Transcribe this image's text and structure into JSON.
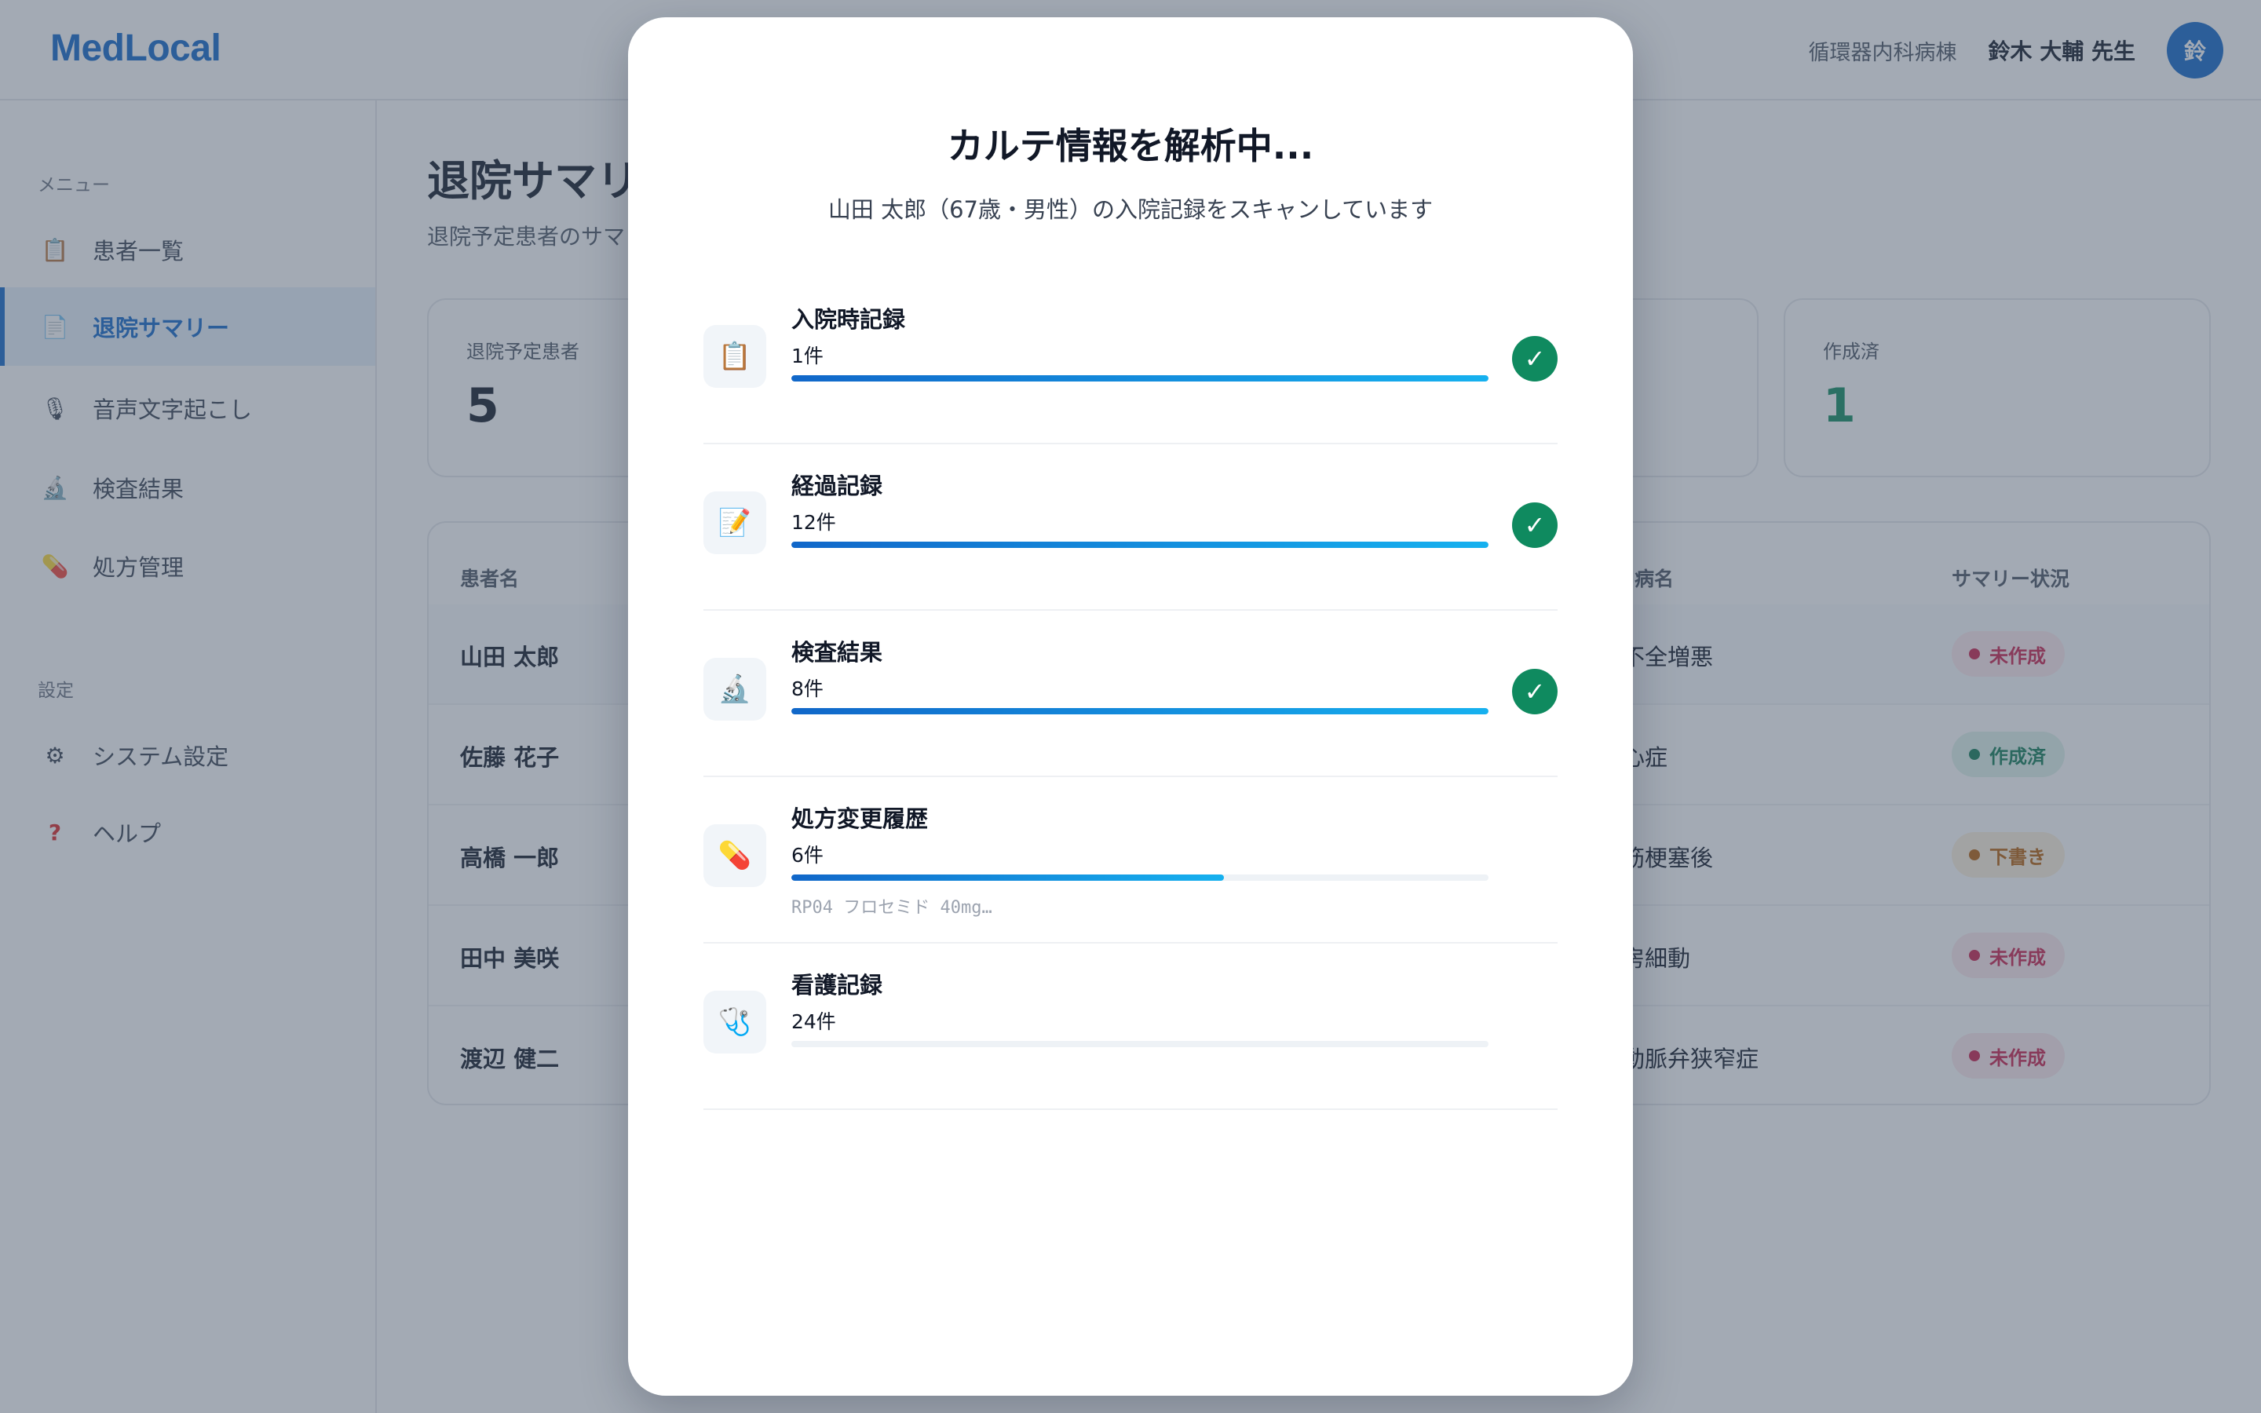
{
  "app": {
    "logo": "MedLocal",
    "ward": "循環器内科病棟",
    "doctor": "鈴木 大輔 先生",
    "avatar_initial": "鈴",
    "brand_color": "#1167c9"
  },
  "sidebar": {
    "menu_heading": "メニュー",
    "settings_heading": "設定",
    "items": [
      {
        "label": "患者一覧",
        "icon": "clipboard-icon"
      },
      {
        "label": "退院サマリー",
        "icon": "document-icon",
        "active": true
      },
      {
        "label": "音声文字起こし",
        "icon": "microphone-icon"
      },
      {
        "label": "検査結果",
        "icon": "microscope-icon"
      },
      {
        "label": "処方管理",
        "icon": "pill-icon"
      }
    ],
    "settings_items": [
      {
        "label": "システム設定",
        "icon": "gear-icon"
      },
      {
        "label": "ヘルプ",
        "icon": "question-icon"
      }
    ]
  },
  "main": {
    "title": "退院サマリ",
    "subtitle": "退院予定患者のサマ",
    "stats": [
      {
        "label": "退院予定患者",
        "value": "5"
      },
      {
        "label": "作成済",
        "value": "1"
      }
    ],
    "table": {
      "headers": [
        "患者名",
        "病名",
        "サマリー状況"
      ],
      "rows": [
        {
          "name": "山田 太郎",
          "diagnosis": "不全増悪",
          "status": "未作成",
          "status_color": "red"
        },
        {
          "name": "佐藤 花子",
          "diagnosis": "心症",
          "status": "作成済",
          "status_color": "green"
        },
        {
          "name": "高橋 一郎",
          "diagnosis": "筋梗塞後",
          "status": "下書き",
          "status_color": "amber"
        },
        {
          "name": "田中 美咲",
          "diagnosis": "房細動",
          "status": "未作成",
          "status_color": "red"
        },
        {
          "name": "渡辺 健二",
          "diagnosis": "動脈弁狭窄症",
          "status": "未作成",
          "status_color": "red"
        }
      ]
    }
  },
  "modal": {
    "title": "カルテ情報を解析中...",
    "subtitle": "山田 太郎（67歳・男性）の入院記録をスキャンしています",
    "steps": [
      {
        "name": "入院時記録",
        "count": "1件",
        "icon": "clipboard-icon",
        "progress": 1.0,
        "done": true,
        "check": "✓"
      },
      {
        "name": "経過記録",
        "count": "12件",
        "icon": "memo-icon",
        "progress": 1.0,
        "done": true,
        "check": "✓"
      },
      {
        "name": "検査結果",
        "count": "8件",
        "icon": "microscope-icon",
        "progress": 1.0,
        "done": true,
        "check": "✓"
      },
      {
        "name": "処方変更履歴",
        "count": "6件",
        "icon": "pill-icon",
        "progress": 0.62,
        "done": false,
        "detail": "RP04 フロセミド 40mg…"
      },
      {
        "name": "看護記録",
        "count": "24件",
        "icon": "stethoscope-icon",
        "progress": 0.0,
        "done": false
      }
    ]
  }
}
